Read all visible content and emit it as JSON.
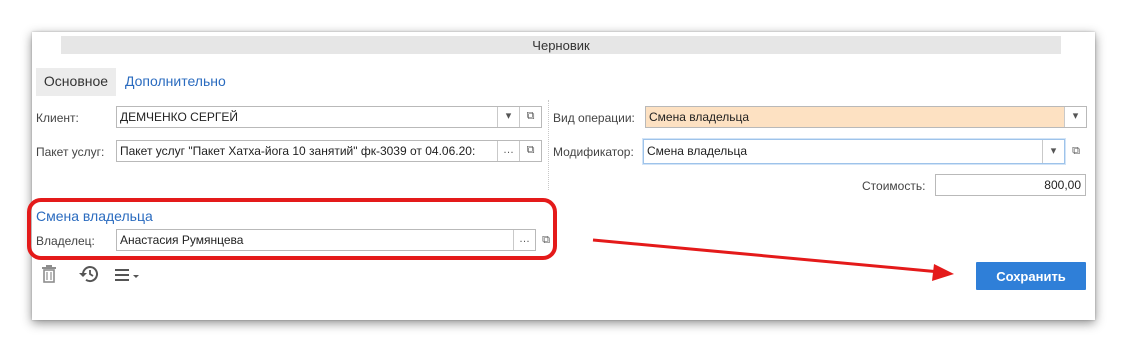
{
  "status": {
    "text": "Черновик"
  },
  "tabs": [
    {
      "label": "Основное",
      "active": true
    },
    {
      "label": "Дополнительно",
      "active": false
    }
  ],
  "form": {
    "client": {
      "label": "Клиент:",
      "value": "ДЕМЧЕНКО СЕРГЕЙ"
    },
    "package": {
      "label": "Пакет услуг:",
      "value": "Пакет услуг \"Пакет Хатха-йога 10 занятий\" фк-3039 от 04.06.20:"
    },
    "operation": {
      "label": "Вид операции:",
      "value": "Смена владельца"
    },
    "modifier": {
      "label": "Модификатор:",
      "value": "Смена владельца"
    },
    "cost": {
      "label": "Стоимость:",
      "value": "800,00"
    }
  },
  "section": {
    "title": "Смена владельца",
    "owner": {
      "label": "Владелец:",
      "value": "Анастасия Румянцева"
    }
  },
  "toolbar": {
    "save_label": "Сохранить"
  },
  "colors": {
    "accent": "#2f7fd8",
    "link": "#2a6bbf",
    "highlight_field": "#fde1c2",
    "annotation": "#e41a1a"
  },
  "icons": {
    "delete": "trash-icon",
    "history": "history-icon",
    "menu": "menu-icon",
    "dropdown": "chevron-down-icon",
    "open": "open-form-icon",
    "select": "ellipsis-icon"
  }
}
